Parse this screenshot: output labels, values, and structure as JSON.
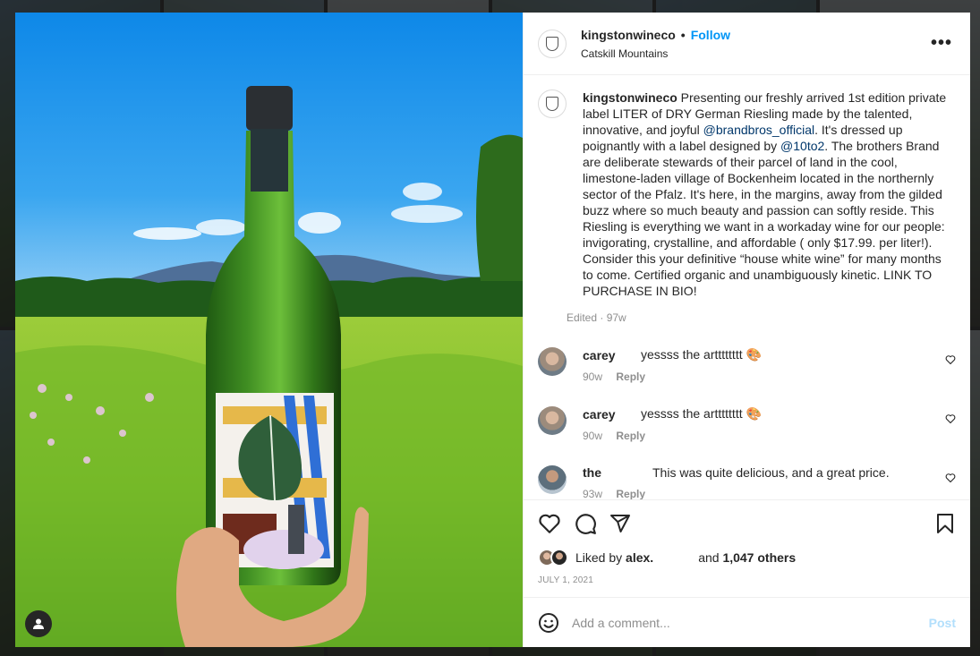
{
  "post": {
    "username": "kingstonwineco",
    "dot": "•",
    "follow_label": "Follow",
    "location": "Catskill Mountains",
    "more_label": "•••"
  },
  "caption": {
    "username": "kingstonwineco",
    "text_1": " Presenting our freshly arrived 1st edition private label LITER of DRY German Riesling made by the talented, innovative, and joyful ",
    "mention_1": "@brandbros_official",
    "text_2": ". It's dressed up poignantly with a label designed by ",
    "mention_2": "@10to2",
    "text_3": ". The brothers Brand are deliberate stewards of their parcel of land in the cool, limestone-laden village of Bockenheim located in the northernly sector of the Pfalz. It's here, in the margins, away from the gilded buzz where so much beauty and passion can softly reside. This Riesling is everything we want in a workaday wine for our people: invigorating, crystalline, and affordable ( only $17.99. per liter!). Consider this your definitive “house white wine” for many months to come. Certified organic and unambiguously kinetic. LINK TO PURCHASE IN BIO!",
    "meta": "Edited · 97w"
  },
  "comments": [
    {
      "user": "carey",
      "text": "yessss the artttttttt 🎨",
      "age": "90w",
      "reply": "Reply"
    },
    {
      "user": "carey",
      "text": "yessss the artttttttt 🎨",
      "age": "90w",
      "reply": "Reply"
    },
    {
      "user": "the",
      "text": "This was quite delicious, and a great price.",
      "age": "93w",
      "reply": "Reply"
    }
  ],
  "likes": {
    "liked_by": "Liked by ",
    "user": "alex.",
    "and_text": "and ",
    "others": "1,047 others"
  },
  "date": "JULY 1, 2021",
  "add_comment": {
    "placeholder": "Add a comment...",
    "post_label": "Post"
  },
  "icons": {
    "more": "more-options-icon",
    "like": "heart-icon",
    "comment": "comment-bubble-icon",
    "share": "share-paper-plane-icon",
    "save": "bookmark-icon",
    "emoji": "emoji-smiley-icon",
    "user_tag": "user-tag-icon"
  },
  "colors": {
    "accent": "#0095f6",
    "post_disabled": "#b2dffc",
    "mention": "#00376b",
    "secondary_text": "#8e8e8e"
  }
}
